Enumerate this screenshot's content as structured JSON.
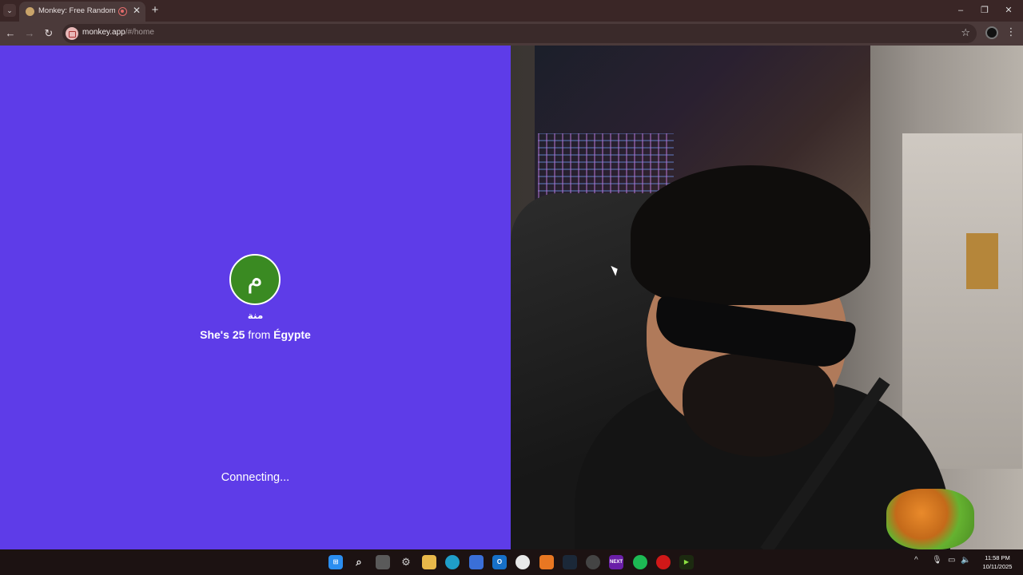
{
  "browser": {
    "tab_title": "Monkey: Free Random Vide",
    "url_host": "monkey.app",
    "url_path": "/#/home"
  },
  "match": {
    "avatar_letter": "م",
    "avatar_color": "#3a8a22",
    "name": "منة",
    "pronoun_prefix": "She's",
    "age": "25",
    "from_label": "from",
    "country": "Égypte",
    "status": "Connecting..."
  },
  "theme": {
    "panel_color": "#5e3ce8"
  },
  "taskbar": {
    "apps": [
      "windows-start",
      "search",
      "task-view",
      "settings",
      "file-explorer",
      "edge",
      "microsoft-store",
      "outlook",
      "chrome",
      "app-orange",
      "steam",
      "app-ai",
      "next",
      "spotify",
      "opera-gx",
      "app-green"
    ],
    "time": "11:58 PM",
    "date": "10/11/2025"
  }
}
